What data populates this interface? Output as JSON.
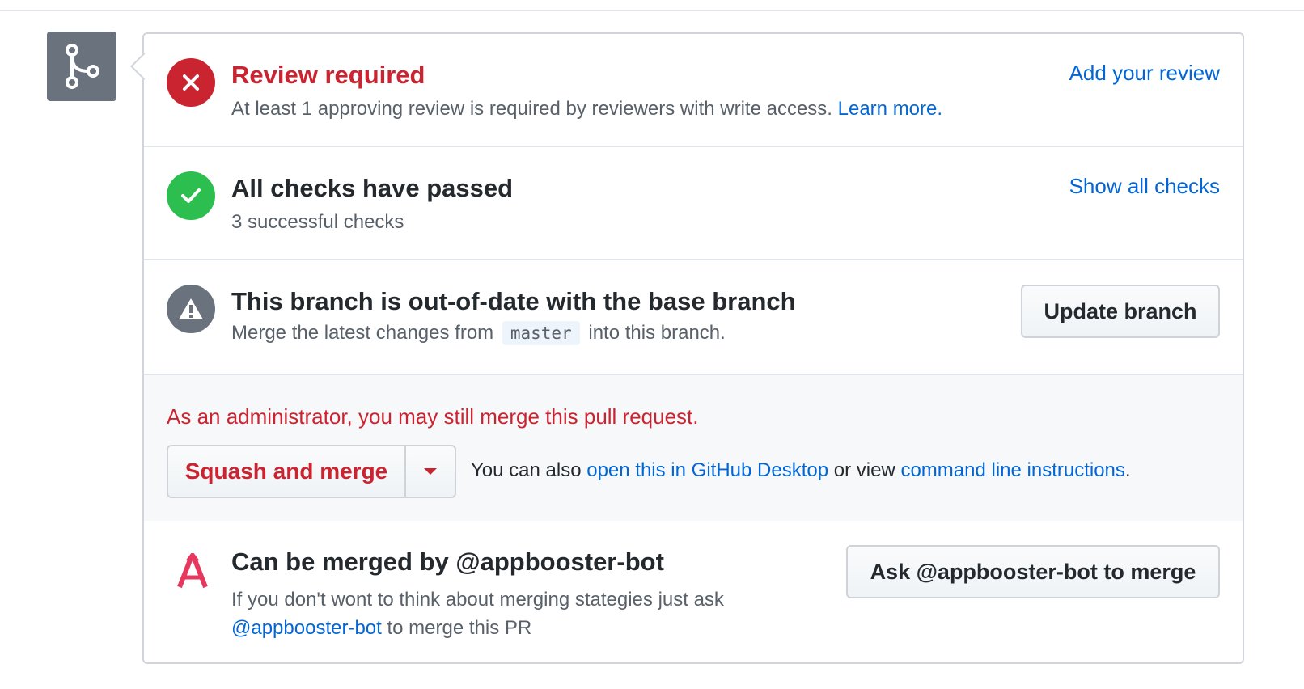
{
  "review": {
    "title": "Review required",
    "description": "At least 1 approving review is required by reviewers with write access.",
    "learn_more": "Learn more.",
    "action": "Add your review"
  },
  "checks": {
    "title": "All checks have passed",
    "description": "3 successful checks",
    "action": "Show all checks"
  },
  "branch": {
    "title": "This branch is out-of-date with the base branch",
    "desc_before": "Merge the latest changes from",
    "base_branch": "master",
    "desc_after": "into this branch.",
    "update_button": "Update branch"
  },
  "admin": {
    "note": "As an administrator, you may still merge this pull request.",
    "merge_button": "Squash and merge",
    "alt_prefix": "You can also",
    "desktop_link": "open this in GitHub Desktop",
    "alt_middle": "or view",
    "cli_link": "command line instructions",
    "alt_suffix": "."
  },
  "bot": {
    "title": "Can be merged by @appbooster-bot",
    "desc_line1": "If you don't wont to think about merging stategies just ask",
    "mention": "@appbooster-bot",
    "desc_line2_suffix": "to merge this PR",
    "ask_button": "Ask @appbooster-bot to merge"
  },
  "colors": {
    "danger": "#cb2431",
    "success": "#2cbe4e",
    "neutral": "#6a737d",
    "link": "#0366d6"
  },
  "icons": [
    "git-merge-icon",
    "x-circle-icon",
    "check-circle-icon",
    "alert-icon",
    "triangle-down-icon",
    "appbooster-logo-icon"
  ]
}
